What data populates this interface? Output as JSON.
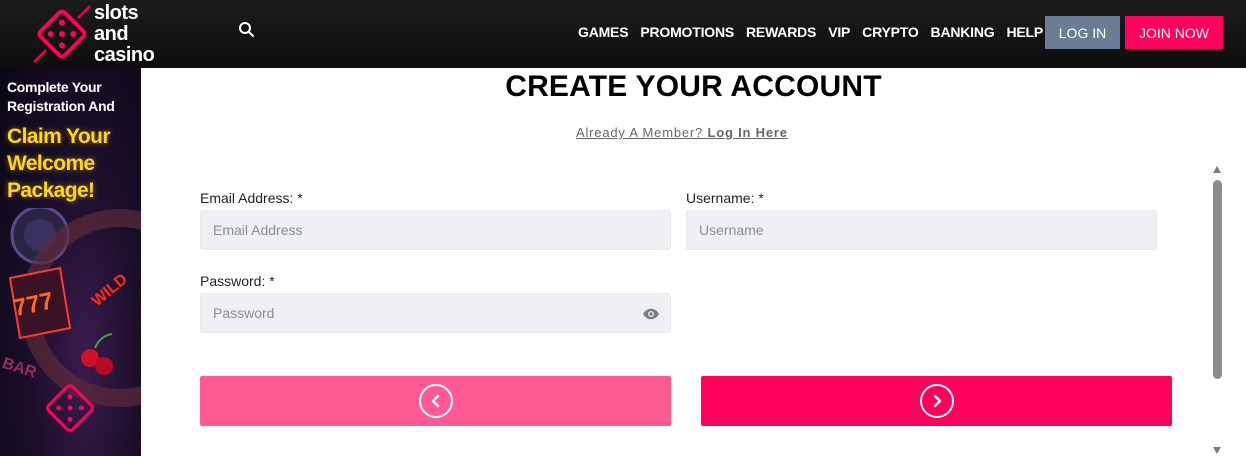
{
  "header": {
    "logo": {
      "line1": "slots",
      "line2": "and",
      "line3": "casino",
      "icon": "dice-icon"
    },
    "search_icon": "search-icon",
    "nav": [
      "GAMES",
      "PROMOTIONS",
      "REWARDS",
      "VIP",
      "CRYPTO",
      "BANKING",
      "HELP"
    ],
    "login_label": "LOG IN",
    "join_label": "JOIN NOW"
  },
  "promo": {
    "line1": "Complete Your Registration And",
    "line2": "Claim Your Welcome Package!"
  },
  "form": {
    "title": "CREATE YOUR ACCOUNT",
    "member_text": "Already A Member?",
    "member_link": "Log In Here",
    "email": {
      "label": "Email Address: *",
      "placeholder": "Email Address",
      "value": ""
    },
    "username": {
      "label": "Username: *",
      "placeholder": "Username",
      "value": ""
    },
    "password": {
      "label": "Password: *",
      "placeholder": "Password",
      "value": "",
      "toggle_icon": "eye-icon"
    },
    "prev_icon": "chevron-left-icon",
    "next_icon": "chevron-right-icon"
  },
  "colors": {
    "header_bg": "#111111",
    "brand_pink": "#ff005a",
    "prev_pink": "#ff5a93",
    "login_gray": "#6c7c94",
    "field_bg": "#eef0f3",
    "promo_yellow": "#ffd61a"
  }
}
